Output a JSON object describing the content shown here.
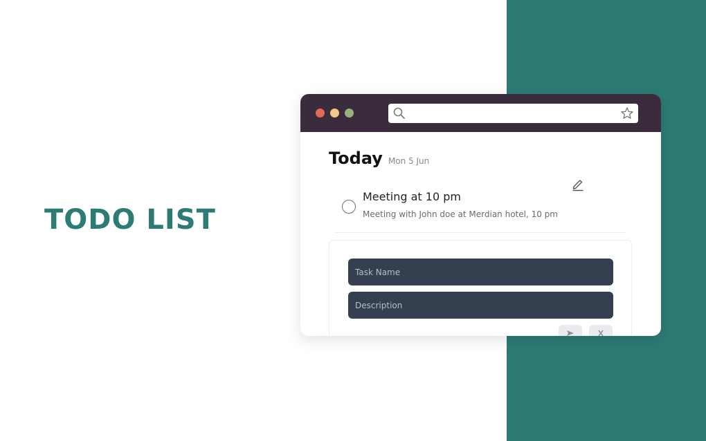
{
  "hero": {
    "title": "TODO LIST"
  },
  "browser": {
    "url_value": "",
    "window_controls": [
      "close",
      "minimize",
      "maximize"
    ]
  },
  "today": {
    "title": "Today",
    "date": "Mon 5 Jun"
  },
  "task": {
    "title": "Meeting at 10 pm",
    "description": "Meeting with John doe at Merdian hotel, 10 pm",
    "completed": false
  },
  "form": {
    "task_name_placeholder": "Task Name",
    "description_placeholder": "Description"
  },
  "colors": {
    "accent": "#2c7b74",
    "titlebar": "#3b2c3d",
    "input_bg": "#363f4f",
    "dot_red": "#e26953",
    "dot_yellow": "#f2c98a",
    "dot_green": "#98b27d"
  },
  "icons": [
    "search-icon",
    "star-icon",
    "edit-icon",
    "send-icon",
    "close-icon"
  ]
}
